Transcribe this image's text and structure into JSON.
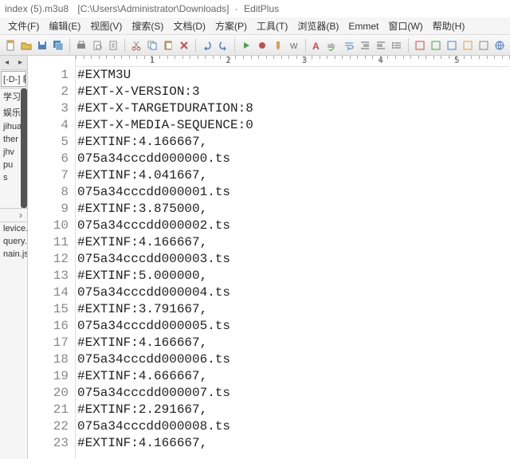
{
  "title": {
    "filename": "index (5).m3u8",
    "path": "[C:\\Users\\Administrator\\Downloads]",
    "app": "EditPlus"
  },
  "menus": [
    "文件(F)",
    "编辑(E)",
    "视图(V)",
    "搜索(S)",
    "文档(D)",
    "方案(P)",
    "工具(T)",
    "浏览器(B)",
    "Emmet",
    "窗口(W)",
    "帮助(H)"
  ],
  "sidebar": {
    "combo": "[-D-] 新.",
    "top_items": [
      "学习",
      "娱乐",
      "jihua",
      "ther",
      "jhv",
      "pu",
      "s"
    ],
    "arrow": "›",
    "files": [
      "levice.m",
      "query.m",
      "nain.js"
    ]
  },
  "lines": [
    "#EXTM3U",
    "#EXT-X-VERSION:3",
    "#EXT-X-TARGETDURATION:8",
    "#EXT-X-MEDIA-SEQUENCE:0",
    "#EXTINF:4.166667,",
    "075a34cccdd000000.ts",
    "#EXTINF:4.041667,",
    "075a34cccdd000001.ts",
    "#EXTINF:3.875000,",
    "075a34cccdd000002.ts",
    "#EXTINF:4.166667,",
    "075a34cccdd000003.ts",
    "#EXTINF:5.000000,",
    "075a34cccdd000004.ts",
    "#EXTINF:3.791667,",
    "075a34cccdd000005.ts",
    "#EXTINF:4.166667,",
    "075a34cccdd000006.ts",
    "#EXTINF:4.666667,",
    "075a34cccdd000007.ts",
    "#EXTINF:2.291667,",
    "075a34cccdd000008.ts",
    "#EXTINF:4.166667,"
  ],
  "ruler_marks": [
    "1",
    "2",
    "3",
    "4",
    "5"
  ],
  "icons": {
    "new": "#e0a050",
    "open": "#e0c050",
    "save": "#5080c0",
    "saveall": "#5080c0",
    "print": "#888",
    "preview": "#888",
    "settings": "#888",
    "cut": "#c05050",
    "copy": "#5080c0",
    "delete": "#c05050",
    "close": "#c05050",
    "undo": "#5080c0",
    "redo": "#5080c0",
    "play": "#50a050",
    "record": "#c05050",
    "marker": "#e0a050",
    "findword": "#888",
    "font": "#c05050",
    "wrap": "#5080c0",
    "indent": "#888",
    "outdent": "#888",
    "list": "#888",
    "col1": "#c05050",
    "col2": "#50a050",
    "col3": "#5080c0",
    "col4": "#e0a050",
    "col5": "#888",
    "browser": "#5080c0"
  }
}
